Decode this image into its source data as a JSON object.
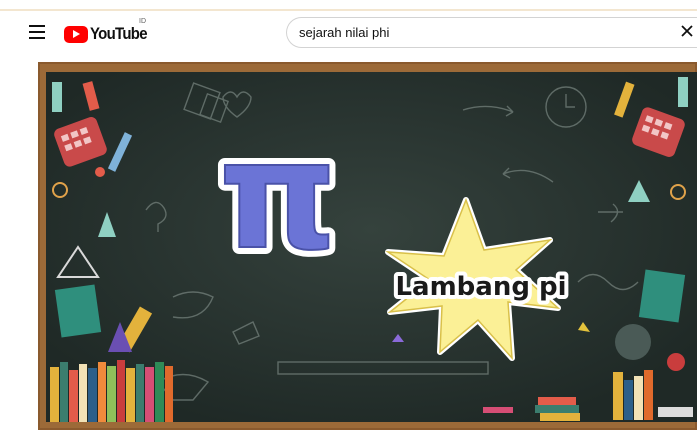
{
  "header": {
    "logo_text": "YouTube",
    "region": "ID",
    "search_value": "sejarah nilai phi",
    "brand_color": "#ff0000"
  },
  "video": {
    "symbol": "π",
    "caption": "Lambang pi",
    "board_color": "#27322e",
    "frame_color": "#8a5a2e",
    "star_color": "#fbf096"
  },
  "icons": [
    "menu-icon",
    "youtube-play-icon",
    "clear-icon"
  ]
}
